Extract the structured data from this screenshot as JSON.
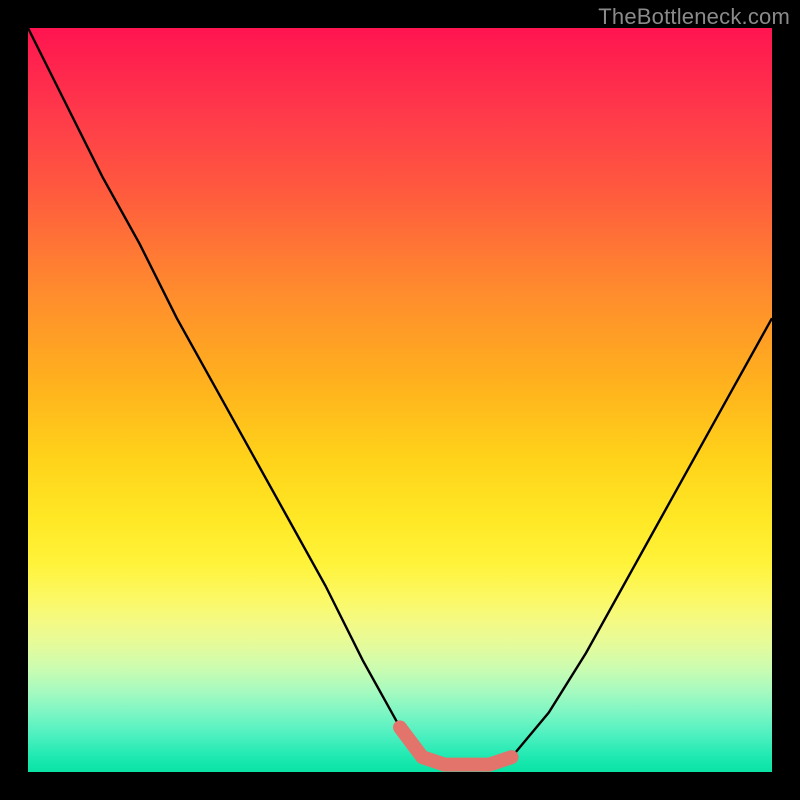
{
  "watermark": "TheBottleneck.com",
  "chart_data": {
    "type": "line",
    "title": "",
    "xlabel": "",
    "ylabel": "",
    "xlim": [
      0,
      100
    ],
    "ylim": [
      0,
      100
    ],
    "grid": false,
    "legend": false,
    "series": [
      {
        "name": "bottleneck-curve",
        "x": [
          0,
          5,
          10,
          15,
          20,
          25,
          30,
          35,
          40,
          45,
          50,
          53,
          56,
          59,
          62,
          65,
          70,
          75,
          80,
          85,
          90,
          95,
          100
        ],
        "values": [
          100,
          90,
          80,
          71,
          61,
          52,
          43,
          34,
          25,
          15,
          6,
          2,
          1,
          1,
          1,
          2,
          8,
          16,
          25,
          34,
          43,
          52,
          61
        ]
      },
      {
        "name": "highlight-segment",
        "x": [
          50,
          53,
          56,
          59,
          62,
          65
        ],
        "values": [
          6,
          2,
          1,
          1,
          1,
          2
        ]
      }
    ],
    "background_gradient": {
      "top": "#ff1450",
      "mid": "#ffe825",
      "bottom": "#09e3a4"
    }
  }
}
